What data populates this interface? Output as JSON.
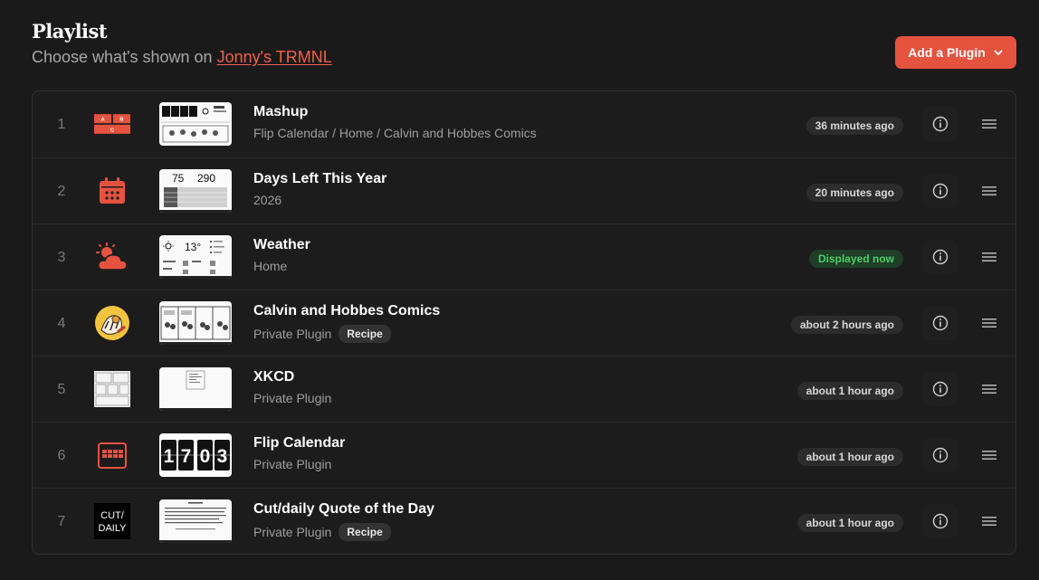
{
  "header": {
    "title": "Playlist",
    "subtitle_prefix": "Choose what's shown on ",
    "device_link": "Jonny's TRMNL",
    "add_button": "Add a Plugin"
  },
  "playlist": [
    {
      "index": "1",
      "name": "Mashup",
      "subtitle": "Flip Calendar / Home / Calvin and Hobbes Comics",
      "recipe": "",
      "status": "36 minutes ago",
      "icon": "mashup-icon"
    },
    {
      "index": "2",
      "name": "Days Left This Year",
      "subtitle": "2026",
      "recipe": "",
      "status": "20 minutes ago",
      "icon": "calendar-icon"
    },
    {
      "index": "3",
      "name": "Weather",
      "subtitle": "Home",
      "recipe": "",
      "status": "Displayed now",
      "icon": "weather-icon"
    },
    {
      "index": "4",
      "name": "Calvin and Hobbes Comics",
      "subtitle": "Private Plugin",
      "recipe": "Recipe",
      "status": "about 2 hours ago",
      "icon": "calvin-hobbes-icon"
    },
    {
      "index": "5",
      "name": "XKCD",
      "subtitle": "Private Plugin",
      "recipe": "",
      "status": "about 1 hour ago",
      "icon": "xkcd-icon"
    },
    {
      "index": "6",
      "name": "Flip Calendar",
      "subtitle": "Private Plugin",
      "recipe": "",
      "status": "about 1 hour ago",
      "icon": "flip-calendar-icon"
    },
    {
      "index": "7",
      "name": "Cut/daily Quote of the Day",
      "subtitle": "Private Plugin",
      "recipe": "Recipe",
      "status": "about 1 hour ago",
      "icon": "cut-daily-icon"
    }
  ],
  "thumbs": {
    "days_left": [
      "75",
      "290"
    ],
    "weather_temp": "13°",
    "flip": [
      "1",
      "7",
      "0",
      "3"
    ],
    "cut_daily": [
      "CUT/",
      "DAILY"
    ],
    "mashup_icon": [
      "A",
      "B",
      "C"
    ]
  },
  "colors": {
    "accent": "#e5533f",
    "status_now_bg": "#1f3d27",
    "status_now_text": "#4ccf6a"
  }
}
